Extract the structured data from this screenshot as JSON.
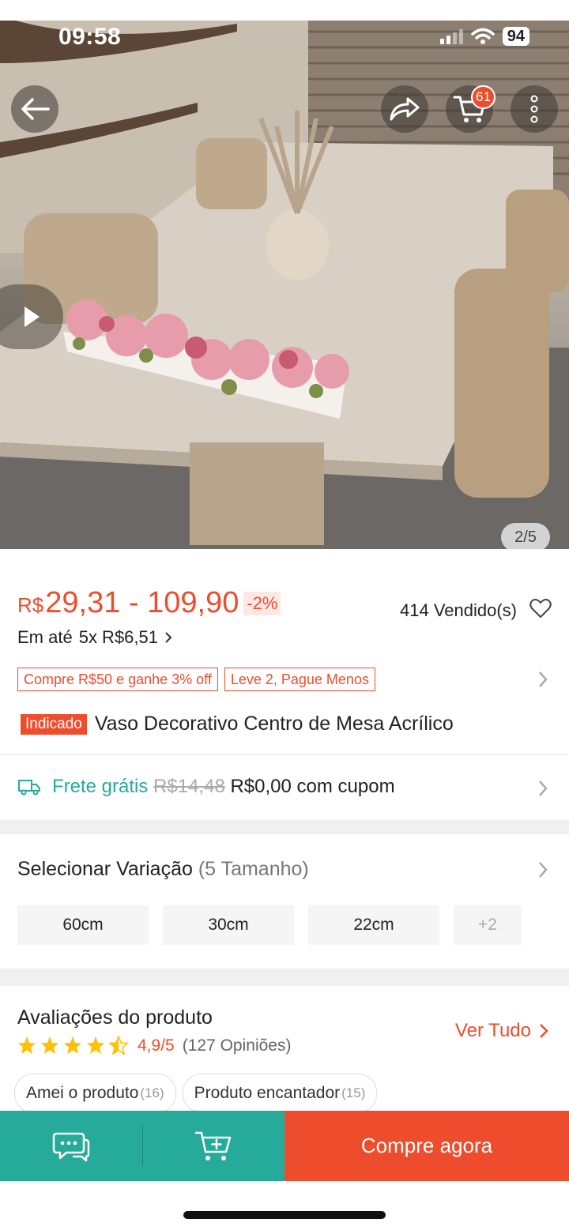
{
  "status_bar": {
    "time": "09:58",
    "battery": "94"
  },
  "gallery": {
    "counter": "2/5",
    "cart_count": "61"
  },
  "price": {
    "currency": "R$",
    "range": "29,31 - 109,90",
    "discount": "-2%",
    "sold": "414 Vendido(s)",
    "installment_prefix": "Em até",
    "installment_value": "5x R$6,51"
  },
  "promos": [
    "Compre R$50 e ganhe 3% off",
    "Leve 2, Pague Menos"
  ],
  "product": {
    "badge": "Indicado",
    "title": "Vaso Decorativo Centro de Mesa Acrílico"
  },
  "shipping": {
    "label": "Frete grátis",
    "old_price": "R$14,48",
    "new_price": "R$0,00 com cupom"
  },
  "variations": {
    "title": "Selecionar Variação",
    "count": "(5 Tamanho)",
    "options": [
      "60cm",
      "30cm",
      "22cm"
    ],
    "more": "+2"
  },
  "reviews": {
    "title": "Avaliações do produto",
    "rating": "4,9/5",
    "count": "(127 Opiniões)",
    "see_all": "Ver Tudo",
    "tags": [
      {
        "label": "Amei o produto",
        "count": "(16)"
      },
      {
        "label": "Produto encantador",
        "count": "(15)"
      }
    ]
  },
  "bottom_bar": {
    "buy_now": "Compre agora"
  },
  "colors": {
    "brand": "#ee4d2d",
    "teal": "#26aa99"
  }
}
